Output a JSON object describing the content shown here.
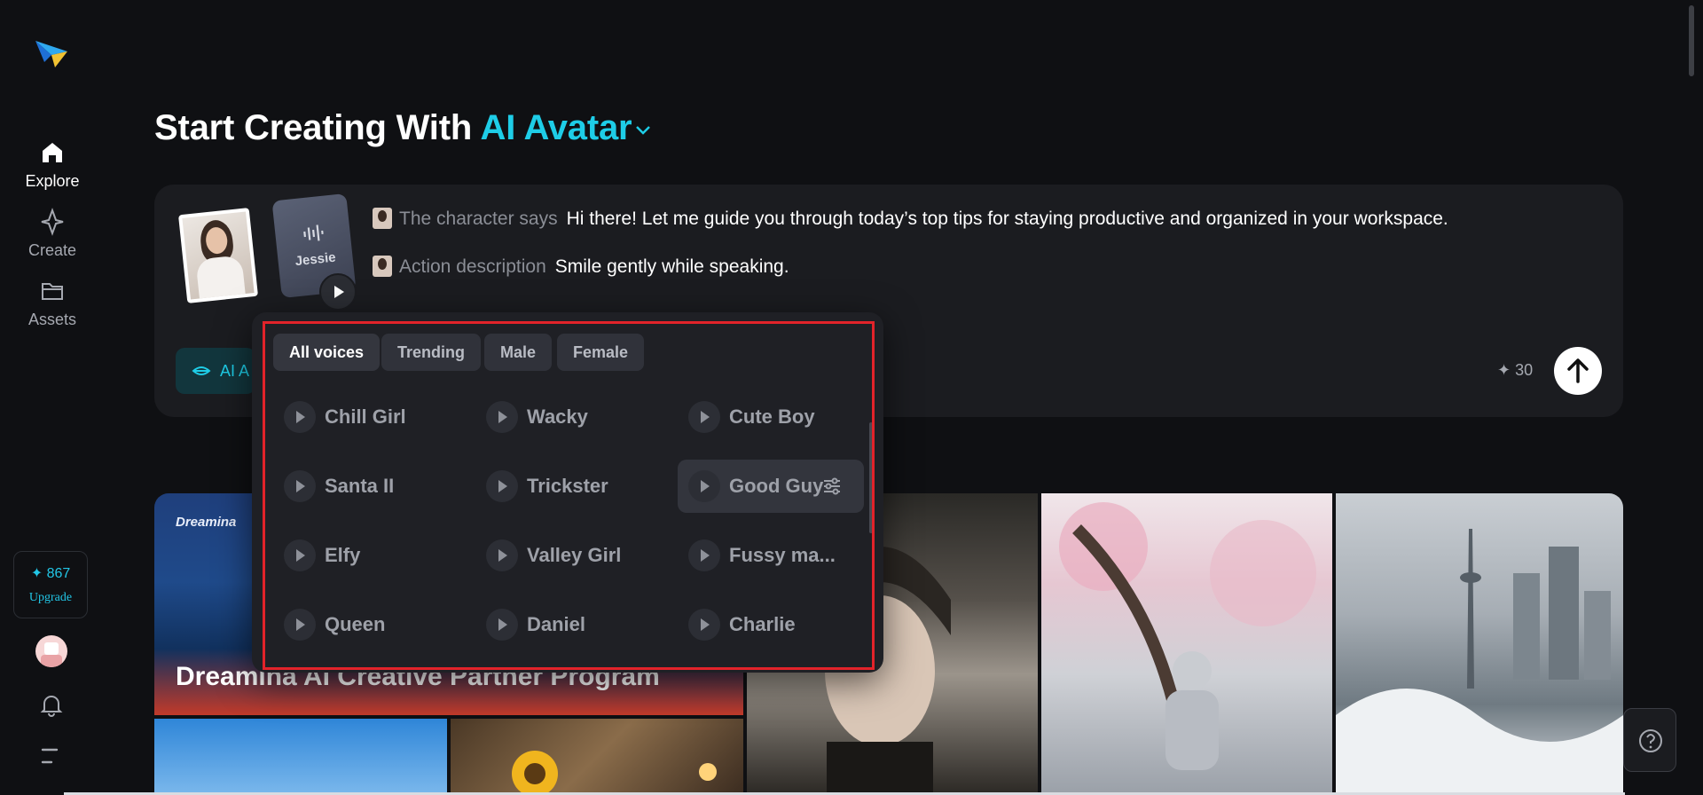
{
  "sidebar": {
    "nav": [
      {
        "label": "Explore"
      },
      {
        "label": "Create"
      },
      {
        "label": "Assets"
      }
    ],
    "credits": "✦ 867",
    "upgrade": "Upgrade"
  },
  "hero": {
    "title_prefix": "Start Creating With",
    "title_accent": "AI Avatar"
  },
  "prompt": {
    "voice_name": "Jessie",
    "character_says_label": "The character says",
    "character_says_text": "Hi there! Let me guide you through today’s top tips for staying productive and organized in your workspace.",
    "action_label": "Action description",
    "action_text": "Smile gently while speaking.",
    "mode_chip": "AI A",
    "cost": "✦ 30"
  },
  "voice_popup": {
    "filters": [
      "All voices",
      "Trending",
      "Male",
      "Female"
    ],
    "voices": [
      "Chill Girl",
      "Wacky",
      "Cute Boy",
      "Santa II",
      "Trickster",
      "Good Guy",
      "Elfy",
      "Valley Girl",
      "Fussy ma...",
      "Queen",
      "Daniel",
      "Charlie"
    ]
  },
  "gallery": {
    "banner_brand": "Dreamina",
    "banner_title": "Dreamina AI Creative Partner Program"
  },
  "colors": {
    "accent": "#1ecde7",
    "highlight_frame": "#e2232a"
  }
}
